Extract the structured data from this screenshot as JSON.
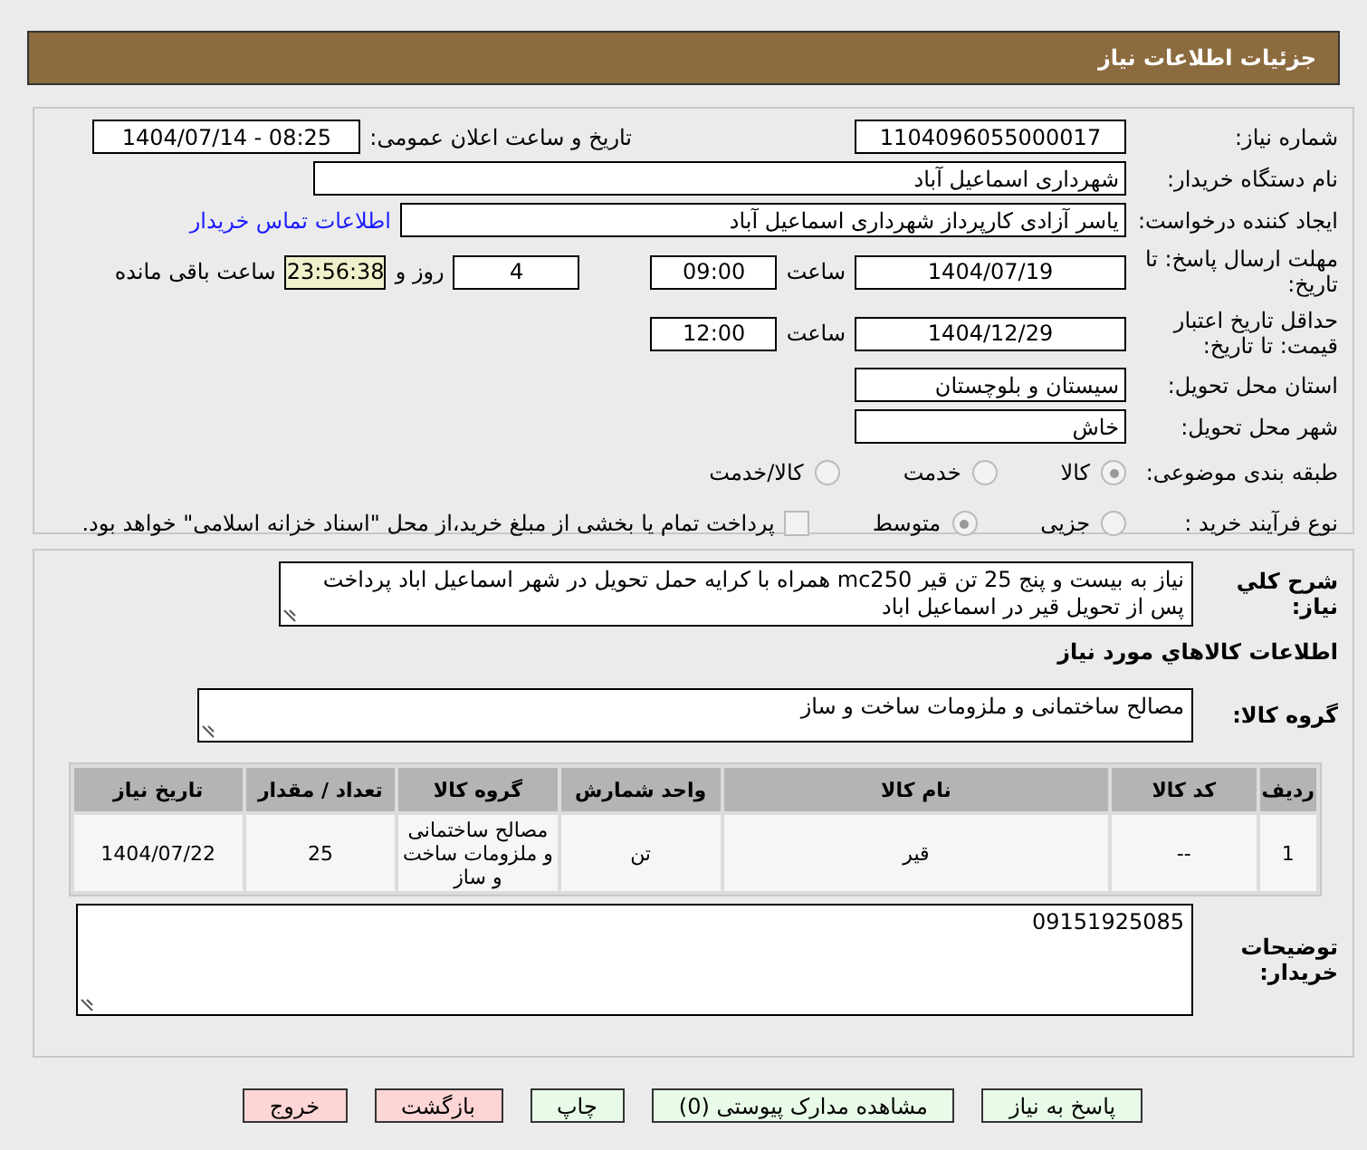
{
  "header": {
    "title": "جزئیات اطلاعات نیاز"
  },
  "need_number": {
    "label": "شماره نیاز:",
    "value": "1104096055000017"
  },
  "announce": {
    "label": "تاریخ و ساعت اعلان عمومی:",
    "value": "1404/07/14 - 08:25"
  },
  "buyer_org": {
    "label": "نام دستگاه خریدار:",
    "value": "شهرداری اسماعیل آباد"
  },
  "requester": {
    "label": "ایجاد کننده درخواست:",
    "value": "یاسر آزادی کارپرداز شهرداری اسماعیل آباد",
    "link": "اطلاعات تماس خریدار"
  },
  "response_deadline": {
    "label": "مهلت ارسال پاسخ: تا تاریخ:",
    "date": "1404/07/19",
    "time_label": "ساعت",
    "time": "09:00",
    "days": "4",
    "days_label": "روز و",
    "remaining": "23:56:38",
    "remaining_label": "ساعت باقی مانده"
  },
  "price_validity": {
    "label": "حداقل تاریخ اعتبار قیمت: تا تاریخ:",
    "date": "1404/12/29",
    "time_label": "ساعت",
    "time": "12:00"
  },
  "province": {
    "label": "استان محل تحویل:",
    "value": "سیستان و بلوچستان"
  },
  "city": {
    "label": "شهر محل تحویل:",
    "value": "خاش"
  },
  "category": {
    "label": "طبقه بندی موضوعی:",
    "options": [
      {
        "label": "کالا",
        "selected": true
      },
      {
        "label": "خدمت",
        "selected": false
      },
      {
        "label": "کالا/خدمت",
        "selected": false
      }
    ]
  },
  "purchase_process": {
    "label": "نوع فرآیند خرید :",
    "options": [
      {
        "label": "جزیی",
        "selected": false
      },
      {
        "label": "متوسط",
        "selected": true
      }
    ],
    "payment_note": {
      "checked": false,
      "text": "پرداخت تمام یا بخشی از مبلغ خرید،از محل \"اسناد خزانه اسلامی\" خواهد بود."
    }
  },
  "description": {
    "label": "شرح کلي نياز:",
    "value": "نیاز به بیست و پنج 25 تن قیر mc250 همراه با کرایه حمل تحویل در شهر اسماعیل اباد پرداخت پس از تحویل قیر در اسماعیل اباد"
  },
  "goods_title": "اطلاعات کالاهاي مورد نياز",
  "goods_group": {
    "label": "گروه کالا:",
    "value": "مصالح ساختمانی و ملزومات ساخت و ساز"
  },
  "table": {
    "columns": [
      "ردیف",
      "کد کالا",
      "نام کالا",
      "واحد شمارش",
      "گروه کالا",
      "تعداد / مقدار",
      "تاریخ نیاز"
    ],
    "rows": [
      [
        "1",
        "--",
        "قیر",
        "تن",
        "مصالح ساختمانی و ملزومات ساخت و ساز",
        "25",
        "1404/07/22"
      ]
    ]
  },
  "buyer_notes": {
    "label": "توضیحات خریدار:",
    "value": "09151925085"
  },
  "buttons": [
    {
      "label": "پاسخ به نیاز",
      "kind": "action"
    },
    {
      "label": "مشاهده مدارک پیوستی (0)",
      "kind": "action"
    },
    {
      "label": "چاپ",
      "kind": "action"
    },
    {
      "label": "بازگشت",
      "kind": "exit"
    },
    {
      "label": "خروج",
      "kind": "exit"
    }
  ]
}
